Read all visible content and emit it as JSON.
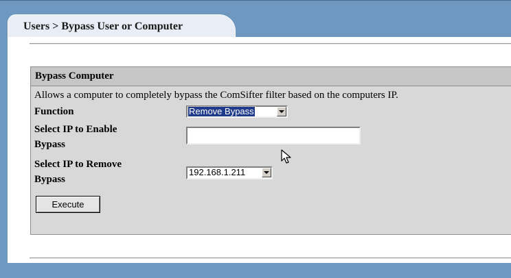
{
  "breadcrumb": "Users > Bypass User or Computer",
  "panel": {
    "title": "Bypass Computer",
    "description": "Allows a computer to completely bypass the ComSifter filter based on the computers IP."
  },
  "form": {
    "function_label": "Function",
    "function_value": "Remove Bypass",
    "enable_label_line1": "Select IP to Enable",
    "enable_label_line2": "Bypass",
    "enable_value": "",
    "remove_label_line1": "Select IP to Remove",
    "remove_label_line2": "Bypass",
    "remove_value": "192.168.1.211",
    "execute_label": "Execute"
  },
  "colors": {
    "frame": "#6f98c0",
    "panel": "#d8d8d8",
    "panel_header": "#c6c6c6",
    "selection": "#1f3a8a"
  },
  "icons": {
    "cursor": "mouse-pointer-icon",
    "dropdown": "chevron-down-icon"
  }
}
